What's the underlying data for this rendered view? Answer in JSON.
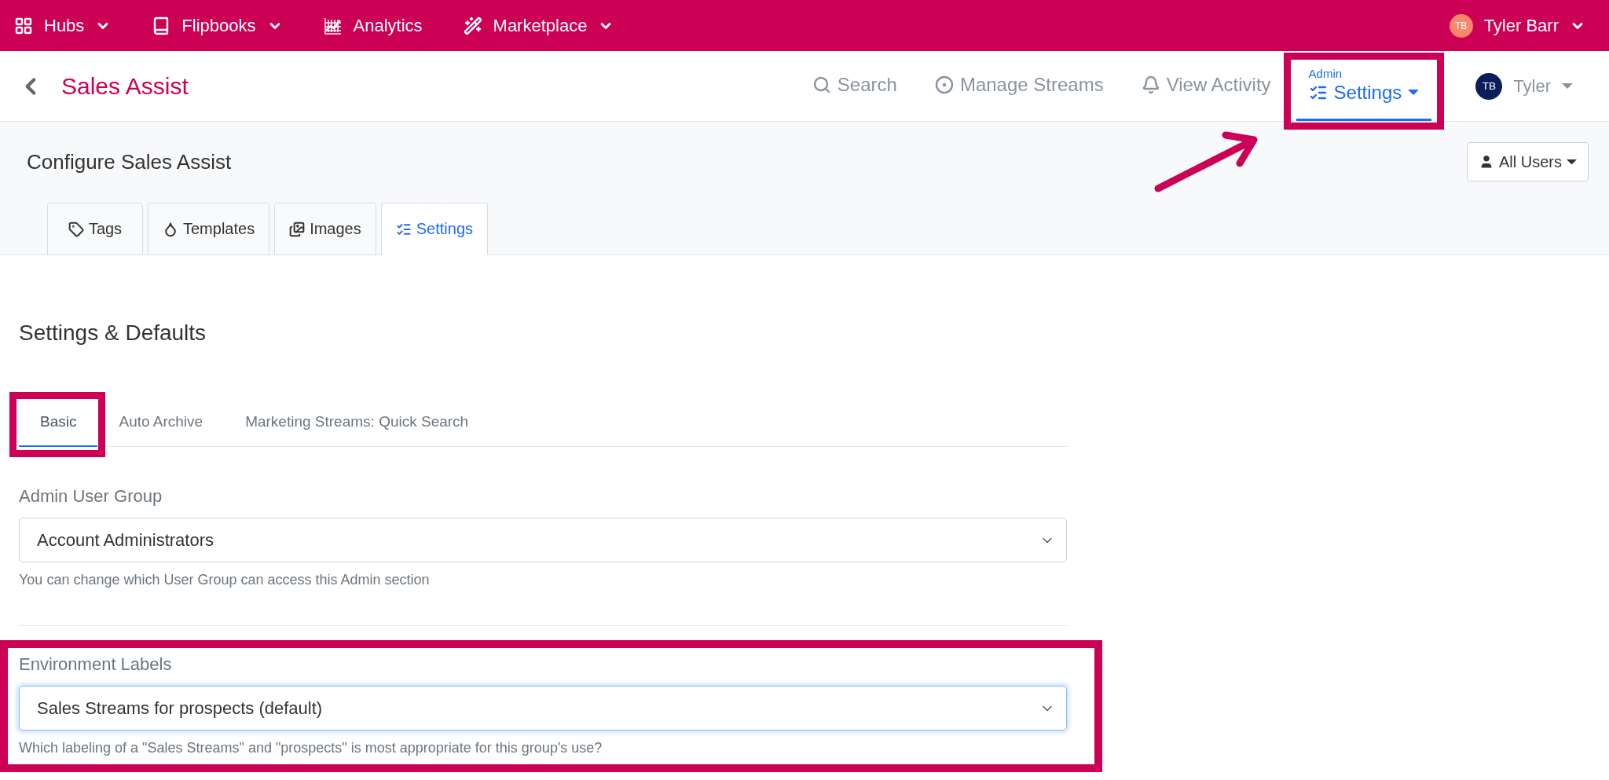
{
  "top_nav": {
    "items": [
      {
        "label": "Hubs",
        "dropdown": true
      },
      {
        "label": "Flipbooks",
        "dropdown": true
      },
      {
        "label": "Analytics",
        "dropdown": false
      },
      {
        "label": "Marketplace",
        "dropdown": true
      }
    ],
    "user": {
      "initials": "TB",
      "name": "Tyler Barr"
    }
  },
  "header": {
    "title": "Sales Assist",
    "nav": [
      {
        "label": "Search",
        "selected": false,
        "highlighted": false
      },
      {
        "label": "Manage Streams",
        "selected": false,
        "highlighted": false
      },
      {
        "label": "View Activity",
        "selected": false,
        "highlighted": false
      },
      {
        "label": "Settings",
        "overline": "Admin",
        "selected": true,
        "highlighted": true
      }
    ],
    "user": {
      "initials": "TB",
      "name": "Tyler"
    }
  },
  "configure": {
    "title": "Configure Sales Assist",
    "filter_button": "All Users",
    "tabs": [
      {
        "label": "Tags",
        "selected": false
      },
      {
        "label": "Templates",
        "selected": false
      },
      {
        "label": "Images",
        "selected": false
      },
      {
        "label": "Settings",
        "selected": true
      }
    ]
  },
  "settings": {
    "title": "Settings & Defaults",
    "tabs": [
      {
        "label": "Basic",
        "selected": true,
        "highlighted": true
      },
      {
        "label": "Auto Archive",
        "selected": false,
        "highlighted": false
      },
      {
        "label": "Marketing Streams: Quick Search",
        "selected": false,
        "highlighted": false
      }
    ],
    "fields": [
      {
        "label": "Admin User Group",
        "value": "Account Administrators",
        "help": "You can change which User Group can access this Admin section",
        "focused": false,
        "highlighted": false
      },
      {
        "label": "Environment Labels",
        "value": "Sales Streams for prospects (default)",
        "help": "Which labeling of a \"Sales Streams\" and \"prospects\" is most appropriate for this group's use?",
        "focused": true,
        "highlighted": true
      }
    ]
  }
}
